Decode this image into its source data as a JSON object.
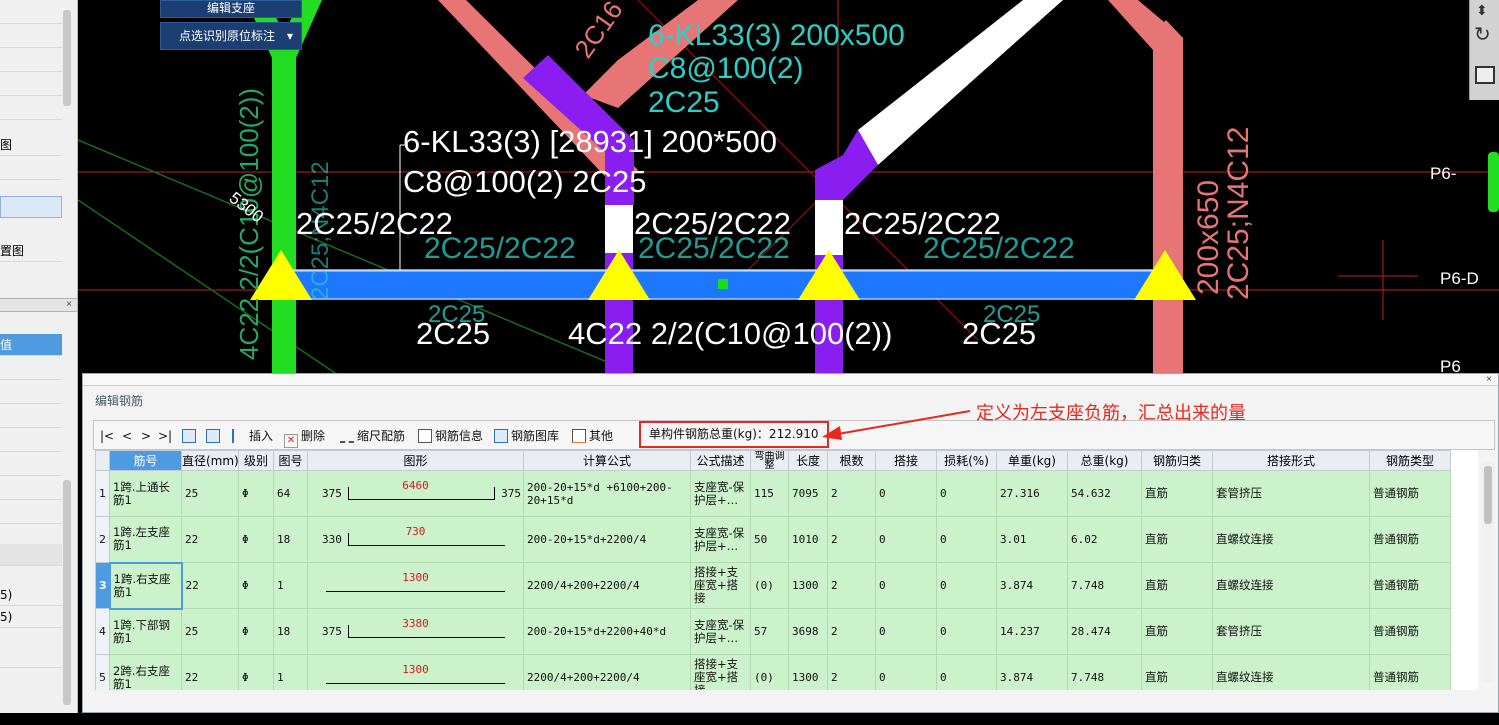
{
  "left_panel": {
    "items": [
      "图",
      "",
      "置图"
    ],
    "lower_items": [
      "值",
      "5)",
      "5)"
    ]
  },
  "cad": {
    "buttons": {
      "edit_support": "编辑支座",
      "pick_annotation": "点选识别原位标注"
    },
    "labels": {
      "beam_name": "6-KL33(3) [28931] 200*500",
      "stirrup": "C8@100(2) 2C25",
      "neg_left": "2C25/2C22",
      "neg_mid": "2C25/2C22",
      "neg_right": "2C25/2C22",
      "bottom_1": "2C25",
      "bottom_2": "4C22 2/2(C10@100(2))",
      "bottom_3": "2C25",
      "dim": "5300",
      "cad_note_top": "6-KL33(3) 200x500",
      "cad_note_c8": "C8@100(2)",
      "cad_note_2c25": "2C25",
      "cad_note_2c16": "2C16",
      "right_sec": "200x650",
      "right_bars": "2C25;N4C12",
      "p6_a": "P6-",
      "p6_b": "P6-D",
      "p6_c": "P6"
    }
  },
  "panel": {
    "title": "编辑钢筋",
    "toolbar": {
      "first": "|<",
      "prev": "<",
      "next": ">",
      "last": ">|",
      "insert": "插入",
      "delete": "删除",
      "scale": "缩尺配筋",
      "rebar_info": "钢筋信息",
      "rebar_lib": "钢筋图库",
      "other": "其他",
      "total": "单构件钢筋总重(kg)：212.910"
    },
    "columns": [
      "",
      "筋号",
      "直径(mm)",
      "级别",
      "图号",
      "图形",
      "计算公式",
      "公式描述",
      "弯曲调整",
      "长度",
      "根数",
      "搭接",
      "损耗(%)",
      "单重(kg)",
      "总重(kg)",
      "钢筋归类",
      "搭接形式",
      "钢筋类型"
    ],
    "rows": [
      {
        "no": "1",
        "name": "1跨.上通长筋1",
        "dia": "25",
        "grade": "Φ",
        "fig": "64",
        "shape_left": "375",
        "shape_mid": "6460",
        "shape_right": "375",
        "formula": "200-20+15*d +6100+200-20+15*d",
        "desc": "支座宽-保护层+…",
        "bend": "115",
        "length": "7095",
        "count": "2",
        "lap": "0",
        "loss": "0",
        "unit_w": "27.316",
        "total_w": "54.632",
        "cat": "直筋",
        "lap_form": "套管挤压",
        "type": "普通钢筋"
      },
      {
        "no": "2",
        "name": "1跨.左支座筋1",
        "dia": "22",
        "grade": "Φ",
        "fig": "18",
        "shape_left": "330",
        "shape_mid": "730",
        "shape_right": "",
        "formula": "200-20+15*d+2200/4",
        "desc": "支座宽-保护层+…",
        "bend": "50",
        "length": "1010",
        "count": "2",
        "lap": "0",
        "loss": "0",
        "unit_w": "3.01",
        "total_w": "6.02",
        "cat": "直筋",
        "lap_form": "直螺纹连接",
        "type": "普通钢筋"
      },
      {
        "no": "3",
        "name": "1跨.右支座筋1",
        "dia": "22",
        "grade": "Φ",
        "fig": "1",
        "shape_left": "",
        "shape_mid": "1300",
        "shape_right": "",
        "formula": "2200/4+200+2200/4",
        "desc": "搭接+支座宽+搭接",
        "bend": "(0)",
        "length": "1300",
        "count": "2",
        "lap": "0",
        "loss": "0",
        "unit_w": "3.874",
        "total_w": "7.748",
        "cat": "直筋",
        "lap_form": "直螺纹连接",
        "type": "普通钢筋"
      },
      {
        "no": "4",
        "name": "1跨.下部钢筋1",
        "dia": "25",
        "grade": "Φ",
        "fig": "18",
        "shape_left": "375",
        "shape_mid": "3380",
        "shape_right": "",
        "formula": "200-20+15*d+2200+40*d",
        "desc": "支座宽-保护层+…",
        "bend": "57",
        "length": "3698",
        "count": "2",
        "lap": "0",
        "loss": "0",
        "unit_w": "14.237",
        "total_w": "28.474",
        "cat": "直筋",
        "lap_form": "套管挤压",
        "type": "普通钢筋"
      },
      {
        "no": "5",
        "name": "2跨.右支座筋1",
        "dia": "22",
        "grade": "Φ",
        "fig": "1",
        "shape_left": "",
        "shape_mid": "1300",
        "shape_right": "",
        "formula": "2200/4+200+2200/4",
        "desc": "搭接+支座宽+搭接",
        "bend": "(0)",
        "length": "1300",
        "count": "2",
        "lap": "0",
        "loss": "0",
        "unit_w": "3.874",
        "total_w": "7.748",
        "cat": "直筋",
        "lap_form": "直螺纹连接",
        "type": "普通钢筋"
      }
    ]
  },
  "annotation": {
    "text": "定义为左支座负筋，汇总出来的量"
  },
  "colors": {
    "accent": "#4e9be2",
    "row_bg": "#ccf2cc",
    "annotation": "#e8281e",
    "beam": "#1e78ff"
  }
}
